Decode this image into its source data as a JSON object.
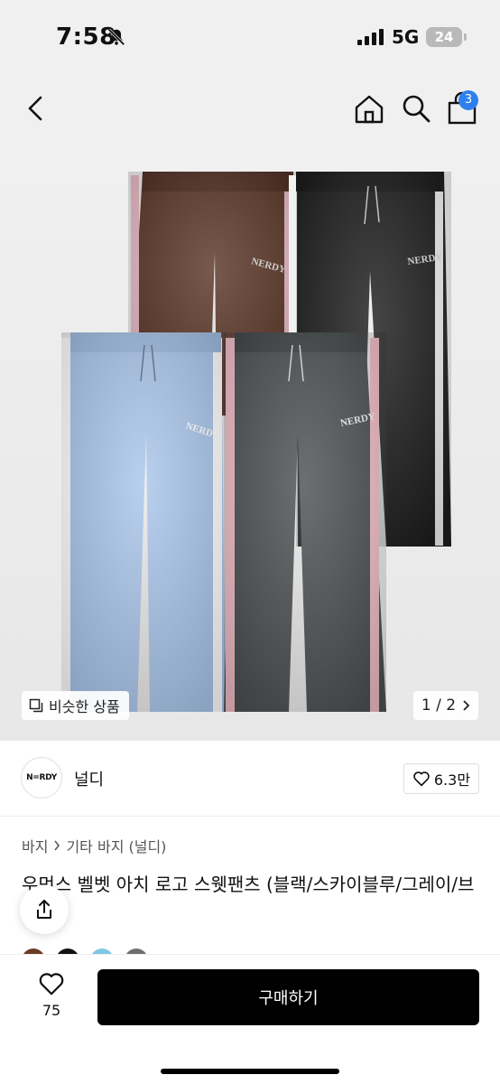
{
  "status": {
    "time": "7:58",
    "network": "5G",
    "battery": "24"
  },
  "header": {
    "cart_count": "3"
  },
  "product_image": {
    "pants": [
      {
        "name": "brown",
        "color": "#5a3526",
        "stripe": "#e8b8c4",
        "logo": "NERDY"
      },
      {
        "name": "black",
        "color": "#1d1d1d",
        "stripe": "#f1f1f1",
        "logo": "NERDY"
      },
      {
        "name": "sky-blue",
        "color": "#a9c6ea",
        "stripe": "#ffffff",
        "logo": "NERDY"
      },
      {
        "name": "gray",
        "color": "#4c5052",
        "stripe": "#efbcc6",
        "logo": "NERDY"
      }
    ],
    "similar_label": "비슷한 상품",
    "page": "1 / 2"
  },
  "seller": {
    "logo_text": "N=RDY",
    "name": "널디",
    "likes": "6.3만"
  },
  "breadcrumb": {
    "category": "바지",
    "subcategory": "기타 바지 (널디)"
  },
  "product": {
    "title": "우먼스 벨벳 아치 로고 스웻팬츠 (블랙/스카이블루/그레이/브라운)",
    "swatches": [
      "#6b3a24",
      "#111111",
      "#7ec8e3",
      "#6f6f6f"
    ]
  },
  "bottom_bar": {
    "wish_count": "75",
    "buy_label": "구매하기"
  }
}
